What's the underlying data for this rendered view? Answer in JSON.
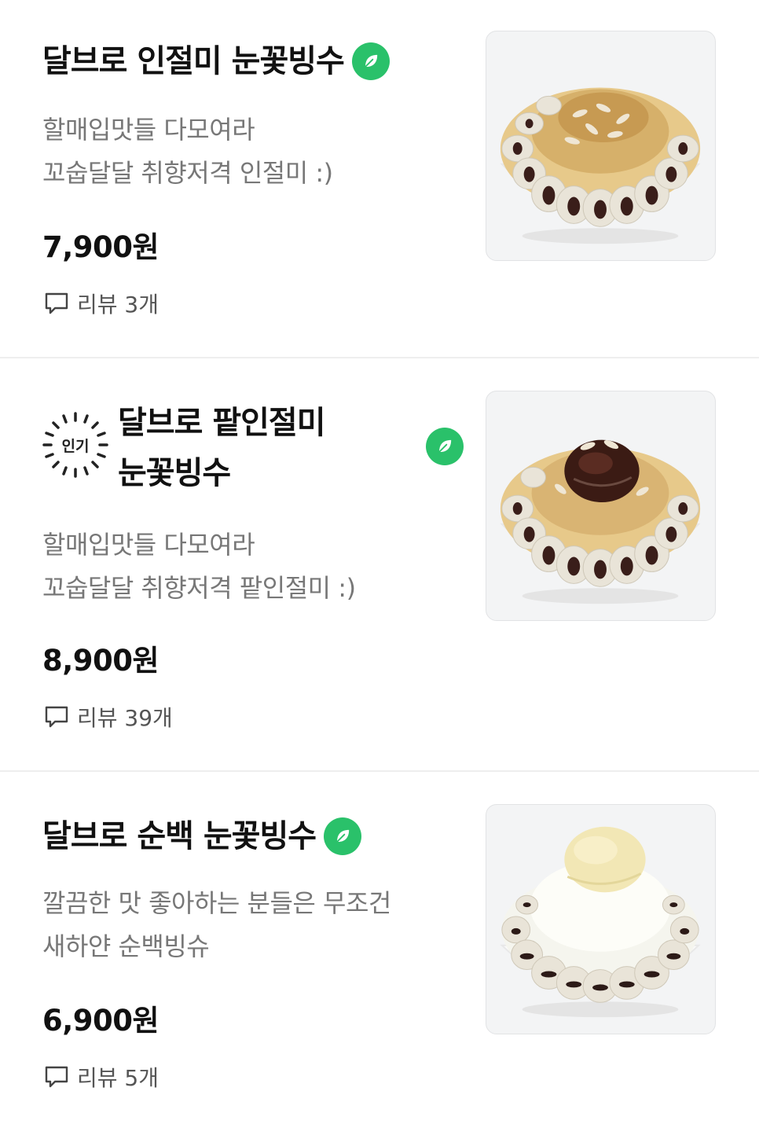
{
  "menu": {
    "items": [
      {
        "name": "달브로 인절미 눈꽃빙수",
        "desc_line1": "할매입맛들 다모여라",
        "desc_line2": "꼬숩달달 취향저격 인절미 :)",
        "price": "7,900원",
        "reviews": "리뷰 3개"
      },
      {
        "badge": "인기",
        "name_line1": "달브로 팥인절미",
        "name_line2": "눈꽃빙수",
        "desc_line1": "할매입맛들 다모여라",
        "desc_line2": "꼬숩달달 취향저격 팥인절미 :)",
        "price": "8,900원",
        "reviews": "리뷰 39개"
      },
      {
        "name": "달브로 순백 눈꽃빙수",
        "desc_line1": "깔끔한 맛 좋아하는 분들은 무조건",
        "desc_line2": "새하얀 순백빙슈",
        "price": "6,900원",
        "reviews": "리뷰 5개"
      }
    ]
  },
  "colors": {
    "leaf_badge": "#2ac16a",
    "divider": "#eeeeee",
    "description_text": "#777777"
  },
  "icons": [
    "leaf-icon",
    "comment-icon",
    "popular-sunburst-icon"
  ]
}
